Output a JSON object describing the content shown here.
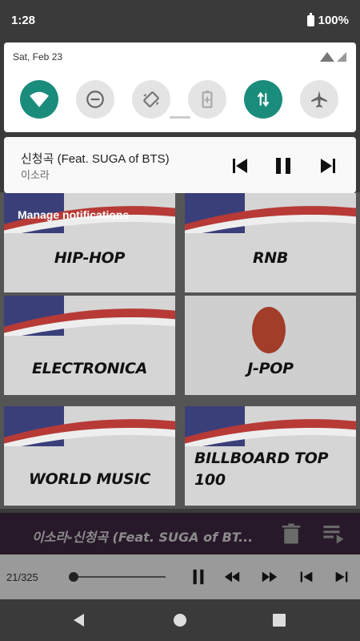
{
  "status_bar": {
    "time": "1:28",
    "battery": "100%"
  },
  "quick_settings": {
    "date": "Sat, Feb 23",
    "tiles": [
      {
        "name": "wifi",
        "state": "on"
      },
      {
        "name": "do-not-disturb",
        "state": "off"
      },
      {
        "name": "auto-rotate",
        "state": "off"
      },
      {
        "name": "battery-saver",
        "state": "off"
      },
      {
        "name": "mobile-data",
        "state": "on"
      },
      {
        "name": "airplane-mode",
        "state": "off"
      }
    ],
    "accent": "#1a8c7c"
  },
  "media_notification": {
    "title": "신청곡 (Feat. SUGA of BTS)",
    "artist": "이소라"
  },
  "manage_notifications": "Manage notifications",
  "genres": [
    {
      "label": "HIP-HOP"
    },
    {
      "label": "RNB"
    },
    {
      "label": "ELECTRONICA"
    },
    {
      "label": "J-POP"
    },
    {
      "label": "WORLD MUSIC"
    },
    {
      "label": "BILLBOARD TOP 100"
    }
  ],
  "now_playing": {
    "song": "이소라-신청곡 (Feat. SUGA of BT..."
  },
  "player": {
    "track_count": "21/325",
    "progress": 0
  }
}
